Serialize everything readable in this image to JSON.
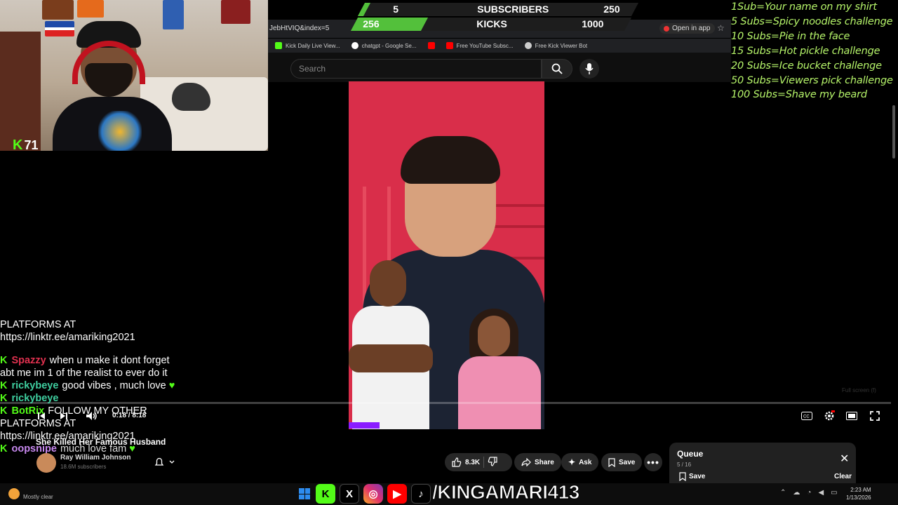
{
  "webcam": {
    "kick_count": "71"
  },
  "goals": [
    {
      "current": "5",
      "label": "SUBSCRIBERS",
      "target": "250",
      "progress": 0.02
    },
    {
      "current": "256",
      "label": "KICKS",
      "target": "1000",
      "progress": 0.256
    }
  ],
  "browser": {
    "url": "JebHtVIQ&index=5",
    "open_in_app": "Open in app",
    "bookmarks": [
      {
        "label": "Kick Daily Live View...",
        "color": "#53fc18"
      },
      {
        "label": "chatgpt - Google Se...",
        "color": "#ffffff"
      },
      {
        "label": "",
        "color": "#ff0000"
      },
      {
        "label": "Free YouTube Subsc...",
        "color": "#ff0000"
      },
      {
        "label": "Free Kick Viewer Bot",
        "color": "#cccccc"
      }
    ]
  },
  "youtube": {
    "search_placeholder": "Search",
    "player": {
      "time": "0:18 / 8:18",
      "progress": 0.036,
      "fullscreen_hint": "Full screen (f)"
    },
    "video": {
      "title": "She Killed Her Famous Husband",
      "channel": "Ray William Johnson",
      "subscribers": "18.6M subscribers",
      "likes": "8.3K",
      "share": "Share",
      "ask": "Ask",
      "save": "Save"
    },
    "queue": {
      "title": "Queue",
      "count": "5 / 16",
      "save": "Save",
      "clear": "Clear"
    }
  },
  "goal_list": [
    "1Sub=Your name on my shirt",
    "5 Subs=Spicy noodles challenge",
    "10 Subs=Pie in the face",
    "15 Subs=Hot pickle challenge",
    "20 Subs=Ice bucket challenge",
    "50 Subs=Viewers pick challenge",
    "100 Subs=Shave my beard"
  ],
  "chat": [
    {
      "user": "",
      "user_color": "#ffffff",
      "text": "PLATFORMS AT https://linktr.ee/amariking2021"
    },
    {
      "user": "Spazzy",
      "user_color": "#e0314f",
      "text": "when u make it dont forget abt me im 1 of the realist to ever do it"
    },
    {
      "user": "rickybeye",
      "user_color": "#3fcfa0",
      "text": "good vibes , much love"
    },
    {
      "user": "rickybeye",
      "user_color": "#3fcfa0",
      "text": ""
    },
    {
      "user": "BotRix",
      "user_color": "#53fc18",
      "text": "FOLLOW MY OTHER PLATFORMS AT https://linktr.ee/amariking2021"
    },
    {
      "user": "oopsnipe",
      "user_color": "#c889f0",
      "text": "much love fam"
    }
  ],
  "taskbar": {
    "weather": "Mostly clear",
    "handle": "/KINGAMARI413",
    "time": "2:23 AM",
    "date": "1/13/2026"
  },
  "colors": {
    "kick_green": "#53fc18",
    "goal_text": "#b6f56a",
    "youtube_red": "#ff0000",
    "progress_purple": "#8a1cff"
  }
}
